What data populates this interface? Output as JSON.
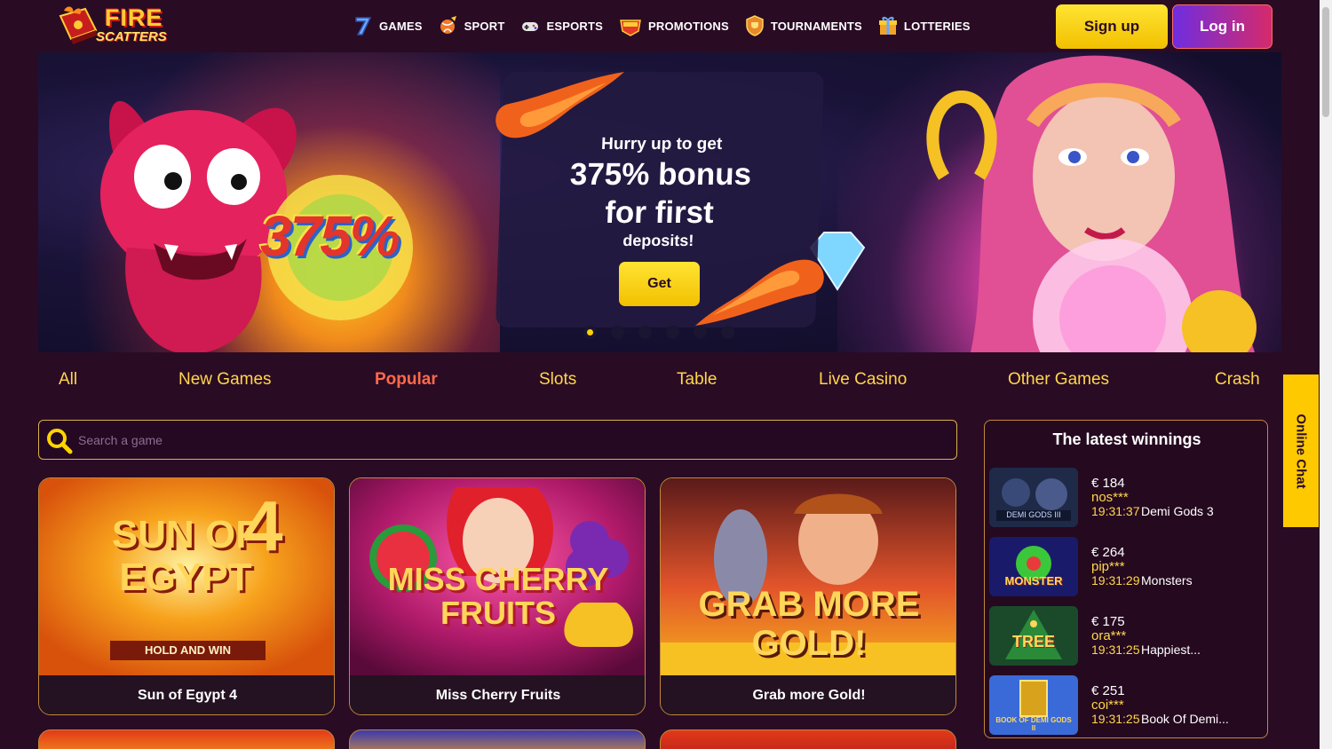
{
  "brand": {
    "line1": "FIRE",
    "line2": "SCATTERS"
  },
  "nav": [
    {
      "label": "GAMES",
      "icon": "seven-icon"
    },
    {
      "label": "SPORT",
      "icon": "ball-icon"
    },
    {
      "label": "ESPORTS",
      "icon": "gamepad-icon"
    },
    {
      "label": "PROMOTIONS",
      "icon": "bonus-badge-icon"
    },
    {
      "label": "TOURNAMENTS",
      "icon": "shield-trophy-icon"
    },
    {
      "label": "LOTTERIES",
      "icon": "gift-icon"
    }
  ],
  "auth": {
    "signup": "Sign up",
    "login": "Log in"
  },
  "banner": {
    "big_number": "375%",
    "line1": "Hurry up to get",
    "line2": "375% bonus",
    "line3": "for first",
    "line4": "deposits!",
    "cta": "Get",
    "slide_count": 6,
    "active_slide": 1
  },
  "categories": [
    "All",
    "New Games",
    "Popular",
    "Slots",
    "Table",
    "Live Casino",
    "Other Games",
    "Crash"
  ],
  "active_category": "Popular",
  "search": {
    "placeholder": "Search a game"
  },
  "games": [
    {
      "name": "Sun of Egypt 4",
      "art_title": "SUN OF EGYPT",
      "art_number": "4",
      "art_sub": "HOLD AND WIN"
    },
    {
      "name": "Miss Cherry Fruits",
      "art_title": "MISS CHERRY FRUITS"
    },
    {
      "name": "Grab more Gold!",
      "art_title": "GRAB MORE GOLD!"
    }
  ],
  "winnings": {
    "title": "The latest winnings",
    "items": [
      {
        "amount": "€ 184",
        "user": "nos***",
        "time": "19:31:37",
        "game": "Demi Gods 3",
        "thumb_text": "DEMI GODS III"
      },
      {
        "amount": "€ 264",
        "user": "pip***",
        "time": "19:31:29",
        "game": "Monsters",
        "thumb_text": "MONSTER"
      },
      {
        "amount": "€ 175",
        "user": "ora***",
        "time": "19:31:25",
        "game": "Happiest...",
        "thumb_text": "TREE"
      },
      {
        "amount": "€ 251",
        "user": "coi***",
        "time": "19:31:25",
        "game": "Book Of Demi...",
        "thumb_text": "BOOK OF DEMI GODS II"
      }
    ]
  },
  "chat": {
    "label": "Online Chat"
  },
  "colors": {
    "accent_yellow": "#ffd74a",
    "active_tab": "#ff6a4a",
    "background": "#2a0b24",
    "login_gradient_start": "#6f2de0",
    "login_gradient_end": "#d62a6a"
  }
}
